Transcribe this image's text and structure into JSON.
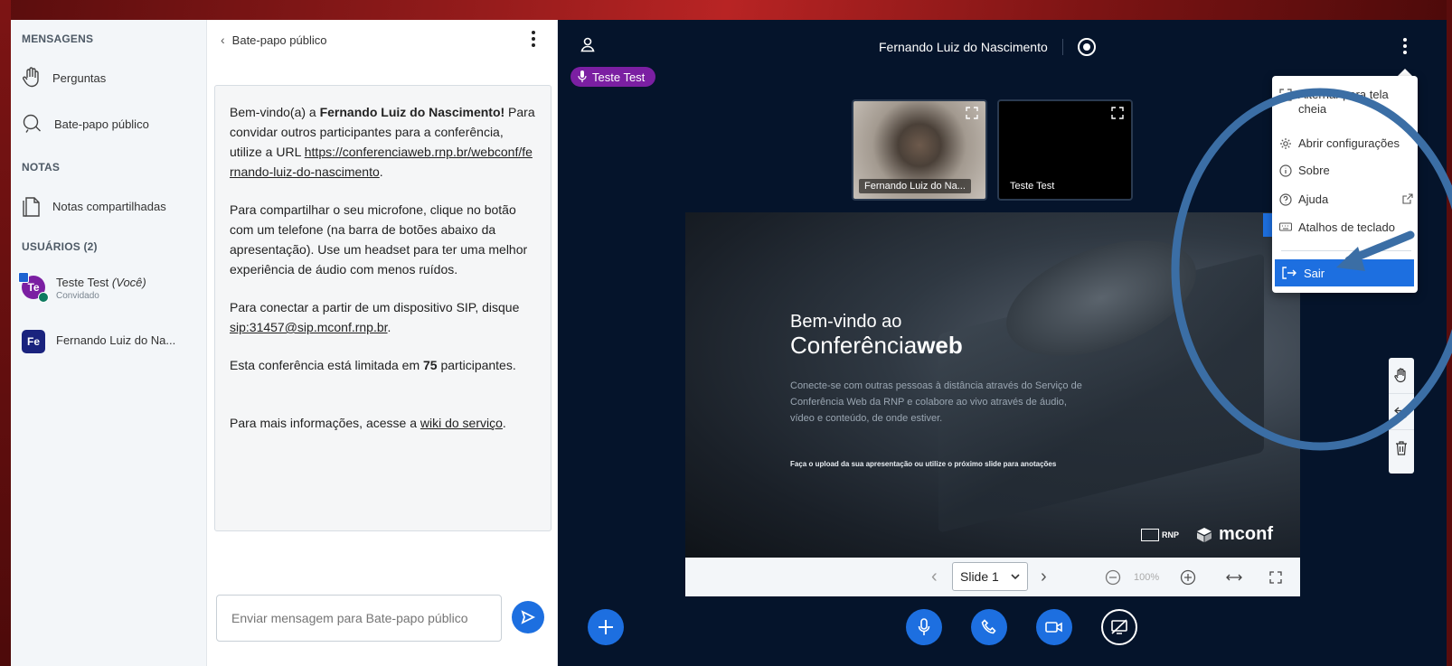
{
  "sidebar": {
    "messages_title": "MENSAGENS",
    "messages_items": [
      {
        "label": "Perguntas",
        "icon": "raised-hand-icon"
      },
      {
        "label": "Bate-papo público",
        "icon": "chat-bubble-icon"
      }
    ],
    "notes_title": "NOTAS",
    "notes_items": [
      {
        "label": "Notas compartilhadas",
        "icon": "notes-icon"
      }
    ],
    "users_title": "USUÁRIOS (2)",
    "users": [
      {
        "initials": "Te",
        "name": "Teste Test",
        "you_suffix": "(Você)",
        "role": "Convidado"
      },
      {
        "initials": "Fe",
        "name": "Fernando Luiz do Na..."
      }
    ]
  },
  "chat": {
    "back_label": "Bate-papo público",
    "welcome": {
      "p1_prefix": "Bem-vindo(a) a ",
      "p1_name": "Fernando Luiz do Nascimento!",
      "p1_mid": " Para convidar outros participantes para a conferência, utilize a URL ",
      "p1_url": "https://conferenciaweb.rnp.br/webconf/fernando-luiz-do-nascimento",
      "p1_end": ".",
      "p2": "Para compartilhar o seu microfone, clique no botão com um telefone (na barra de botões abaixo da apresentação). Use um headset para ter uma melhor experiência de áudio com menos ruídos.",
      "p3_prefix": "Para conectar a partir de um dispositivo SIP, disque ",
      "p3_sip": "sip:31457@sip.mconf.rnp.br",
      "p3_end": ".",
      "p4_prefix": "Esta conferência está limitada em ",
      "p4_count": "75",
      "p4_suffix": " participantes.",
      "p5_prefix": "Para mais informações, acesse a ",
      "p5_link": "wiki do serviço",
      "p5_end": "."
    },
    "input_placeholder": "Enviar mensagem para Bate-papo público"
  },
  "main": {
    "talker": "Teste Test",
    "meeting_title": "Fernando Luiz do Nascimento",
    "videos": [
      {
        "label": "Fernando Luiz do Na..."
      },
      {
        "label": "Teste Test"
      }
    ],
    "slide": {
      "heading1": "Bem-vindo ao",
      "heading2_light": "Conferência",
      "heading2_bold": "web",
      "body": "Conecte-se com outras pessoas à distância através do Serviço de Conferência Web da RNP e colabore ao vivo através de áudio, vídeo e conteúdo, de onde estiver.",
      "note": "Faça o upload da sua apresentação ou utilize o próximo slide para anotações",
      "logo_rnp": "RNP",
      "logo_mconf": "mconf"
    },
    "slide_bar": {
      "selected": "Slide 1",
      "zoom": "100%"
    }
  },
  "menu": {
    "items": [
      {
        "label": "Alternar para tela cheia",
        "icon": "fullscreen-icon"
      },
      {
        "label": "Abrir configurações",
        "icon": "gear-icon"
      },
      {
        "label": "Sobre",
        "icon": "info-icon"
      },
      {
        "label": "Ajuda",
        "icon": "help-icon"
      },
      {
        "label": "Atalhos de teclado",
        "icon": "keyboard-icon"
      }
    ],
    "sair": "Sair"
  },
  "colors": {
    "accent_blue": "#1d6fe0",
    "purple": "#7b1fa2",
    "navy_bg": "#05142b",
    "annotation": "#3b6ea5"
  }
}
